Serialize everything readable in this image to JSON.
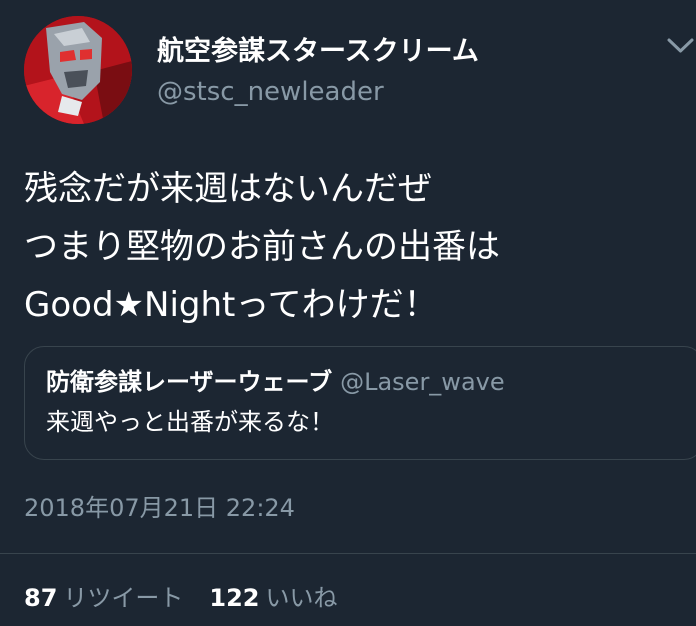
{
  "tweet": {
    "author": {
      "display_name": "航空参謀スタースクリーム",
      "handle": "@stsc_newleader"
    },
    "body_lines": [
      "残念だが来週はないんだぜ",
      "つまり堅物のお前さんの出番は",
      "Good★Nightってわけだ！"
    ],
    "quoted": {
      "display_name": "防衛参謀レーザーウェーブ",
      "handle": "@Laser_wave",
      "text": "来週やっと出番が来るな！"
    },
    "timestamp": "2018年07月21日 22:24",
    "stats": {
      "retweets_count": "87",
      "retweets_label": "リツイート",
      "likes_count": "122",
      "likes_label": "いいね"
    }
  },
  "icons": {
    "avatar": "robot-avatar",
    "menu": "chevron-down-icon"
  },
  "colors": {
    "background": "#1c2632",
    "primary_text": "#ffffff",
    "secondary_text": "#8899a6",
    "border": "#38444d"
  }
}
